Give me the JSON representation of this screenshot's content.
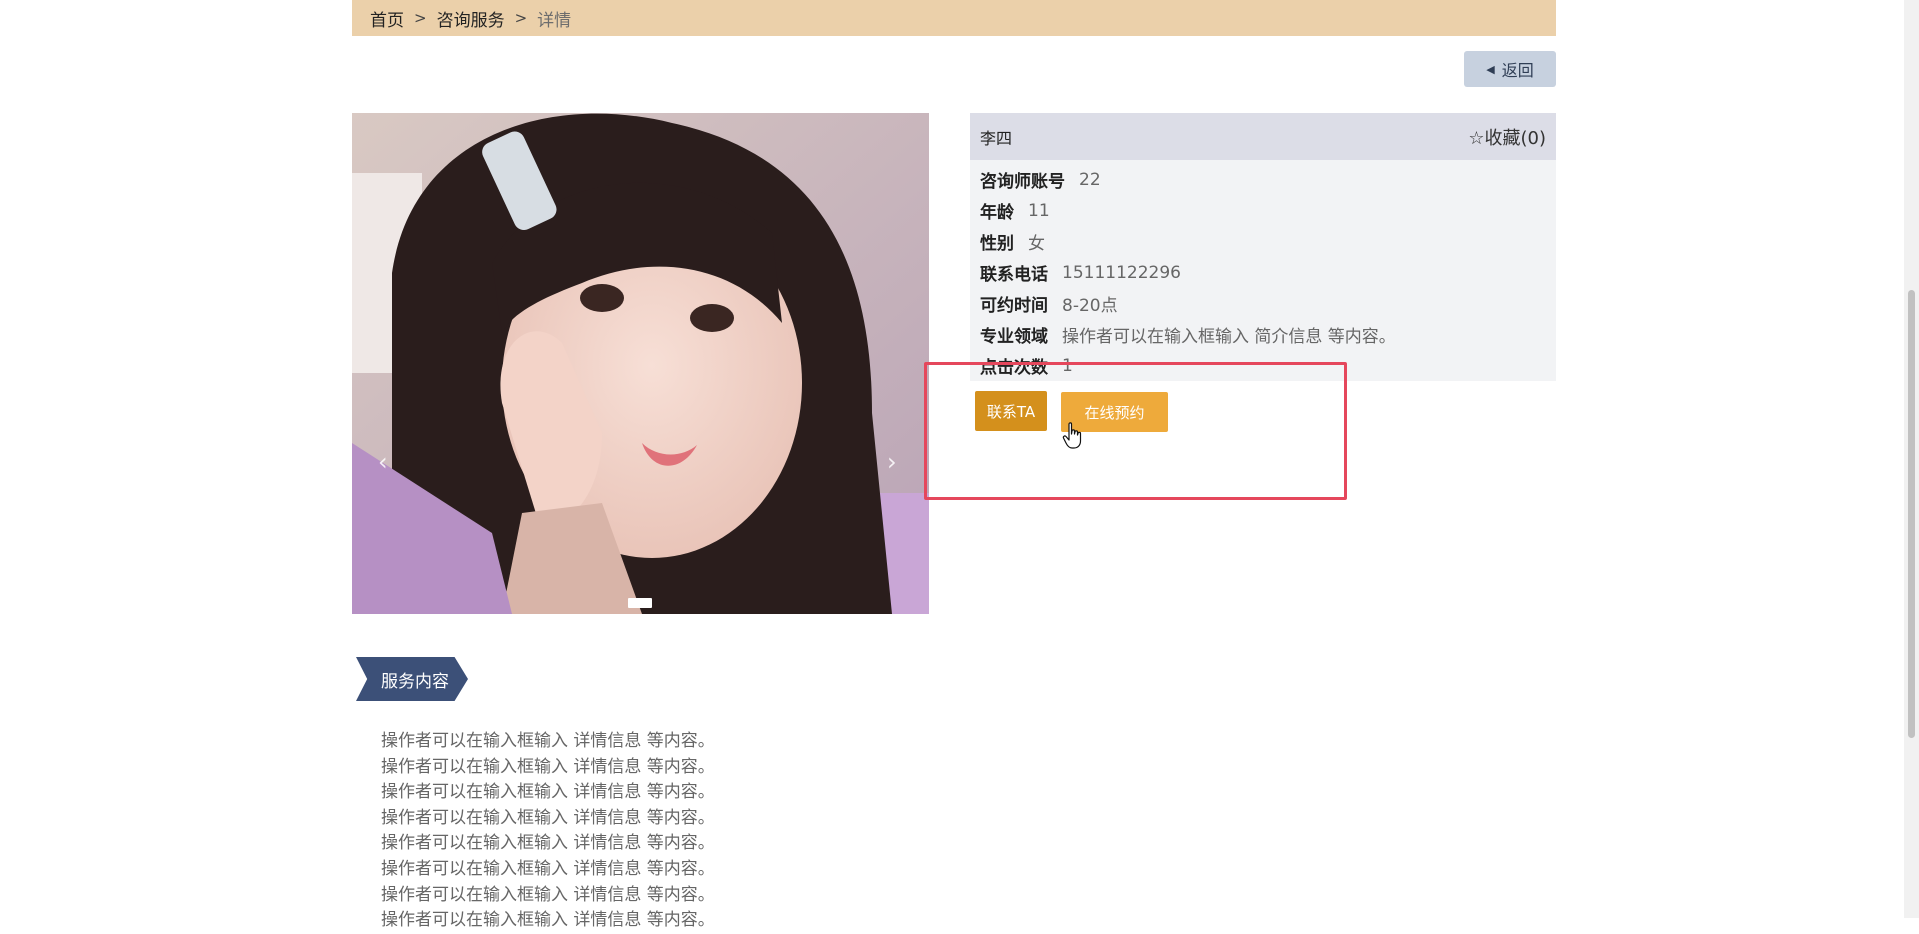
{
  "breadcrumb": {
    "home": "首页",
    "sep1": ">",
    "services": "咨询服务",
    "sep2": ">",
    "current": "详情"
  },
  "back_button": {
    "icon": "caret-left-icon",
    "label": "返回"
  },
  "gallery": {
    "prev_arrow": "‹",
    "next_arrow": "›",
    "slide_count": 1,
    "active_slide": 1
  },
  "consultant": {
    "name": "李四",
    "favorite_label": "☆收藏(0)",
    "fields": [
      {
        "label": "咨询师账号",
        "value": "22"
      },
      {
        "label": "年龄",
        "value": "11"
      },
      {
        "label": "性别",
        "value": "女"
      },
      {
        "label": "联系电话",
        "value": "15111122296"
      },
      {
        "label": "可约时间",
        "value": "8-20点"
      },
      {
        "label": "专业领域",
        "value": "操作者可以在输入框输入 简介信息 等内容。"
      },
      {
        "label": "点击次数",
        "value": "1"
      }
    ]
  },
  "actions": {
    "contact_label": "联系TA",
    "book_label": "在线预约"
  },
  "service_section": {
    "title": "服务内容",
    "lines": [
      "操作者可以在输入框输入  详情信息  等内容。",
      "操作者可以在输入框输入  详情信息  等内容。",
      "操作者可以在输入框输入  详情信息  等内容。",
      "操作者可以在输入框输入  详情信息  等内容。",
      "操作者可以在输入框输入  详情信息  等内容。",
      "操作者可以在输入框输入  详情信息  等内容。",
      "操作者可以在输入框输入  详情信息  等内容。",
      "操作者可以在输入框输入  详情信息  等内容。"
    ]
  },
  "colors": {
    "breadcrumb_bg": "#ebd0aa",
    "back_bg": "#c7d1df",
    "contact_btn": "#d4901c",
    "book_btn": "#eeaa3b",
    "highlight_border": "#e5475c",
    "section_title_bg": "#3c5078"
  }
}
